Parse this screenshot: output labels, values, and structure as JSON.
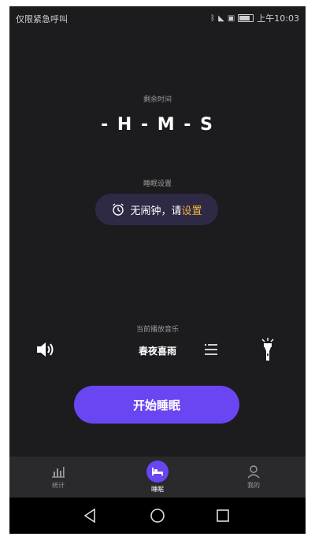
{
  "status": {
    "left_text": "仅限紧急呼叫",
    "time": "上午10:03"
  },
  "countdown": {
    "label": "剩余时间",
    "value": "- H - M - S"
  },
  "sleep_setting": {
    "label": "睡眠设置",
    "alarm_text": "无闹钟，请",
    "alarm_link": "设置"
  },
  "music": {
    "label": "当前播放音乐",
    "track": "春夜喜雨"
  },
  "start_button": {
    "label": "开始睡眠"
  },
  "tabs": [
    {
      "label": "统计",
      "icon": "bar-chart-icon"
    },
    {
      "label": "睡眠",
      "icon": "bed-icon"
    },
    {
      "label": "我的",
      "icon": "person-icon"
    }
  ],
  "colors": {
    "accent": "#6a45f2",
    "link": "#f0b33a",
    "background": "#1c1c1e"
  }
}
